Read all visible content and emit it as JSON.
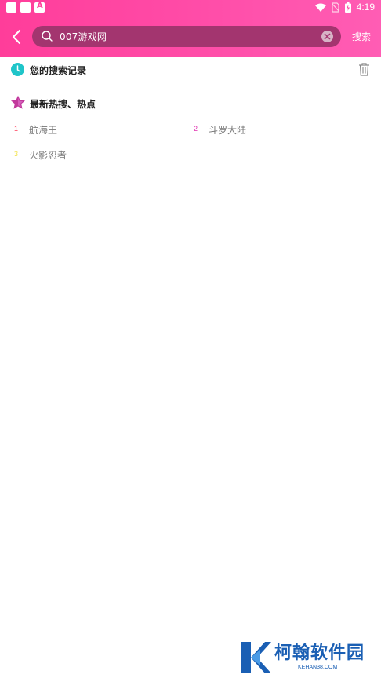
{
  "status_bar": {
    "time": "4:19"
  },
  "search": {
    "query": "007游戏网",
    "submit_label": "搜索"
  },
  "history": {
    "title": "您的搜索记录"
  },
  "hot": {
    "title": "最新热搜、热点",
    "items": [
      {
        "rank": "1",
        "name": "航海王",
        "color": "#ff3d5a"
      },
      {
        "rank": "2",
        "name": "斗罗大陆",
        "color": "#e02fb0"
      },
      {
        "rank": "3",
        "name": "火影忍者",
        "color": "#f2e24a"
      }
    ]
  },
  "colors": {
    "accent": "#ff3d9a",
    "history_icon": "#1fc5c9",
    "star_icon": "#c2399c"
  },
  "watermark": {
    "title": "柯翰软件园",
    "subtitle": "KEHAN38.COM"
  }
}
